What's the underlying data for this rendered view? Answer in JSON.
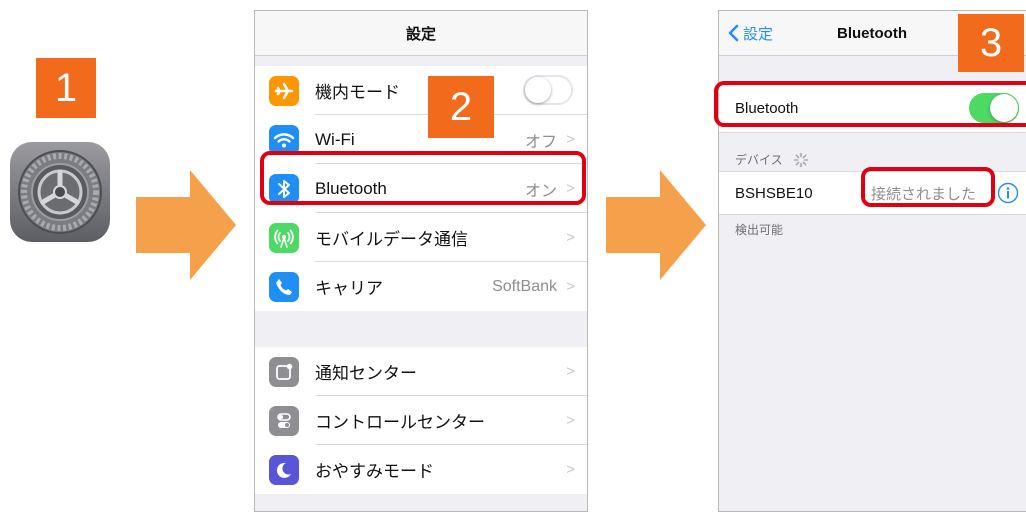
{
  "steps": {
    "one": "1",
    "two": "2",
    "three": "3"
  },
  "settings_screen": {
    "title": "設定",
    "rows": [
      {
        "label": "機内モード",
        "value": "",
        "icon": "airplane-icon",
        "color": "#ff9500"
      },
      {
        "label": "Wi-Fi",
        "value": "オフ",
        "icon": "wifi-icon",
        "color": "#1f8ff6"
      },
      {
        "label": "Bluetooth",
        "value": "オン",
        "icon": "bluetooth-icon",
        "color": "#1f8ff6"
      },
      {
        "label": "モバイルデータ通信",
        "value": "",
        "icon": "cellular-icon",
        "color": "#4cd964"
      },
      {
        "label": "キャリア",
        "value": "SoftBank",
        "icon": "phone-icon",
        "color": "#1f8ff6"
      },
      {
        "label": "通知センター",
        "value": "",
        "icon": "notification-center-icon",
        "color": "#8e8e93"
      },
      {
        "label": "コントロールセンター",
        "value": "",
        "icon": "control-center-icon",
        "color": "#8e8e93"
      },
      {
        "label": "おやすみモード",
        "value": "",
        "icon": "moon-icon",
        "color": "#5856d6"
      }
    ],
    "chevron": ">"
  },
  "bluetooth_screen": {
    "back_label": "設定",
    "title": "Bluetooth",
    "toggle_label": "Bluetooth",
    "devices_header": "デバイス",
    "device_name": "BSHSBE10",
    "device_status": "接続されました",
    "discoverable_text": "検出可能"
  },
  "colors": {
    "badge": "#f26b1d",
    "arrow": "#f5a04a",
    "highlight": "#e00012",
    "toggle_on": "#4cd964",
    "ios_blue": "#1f8ff6"
  }
}
